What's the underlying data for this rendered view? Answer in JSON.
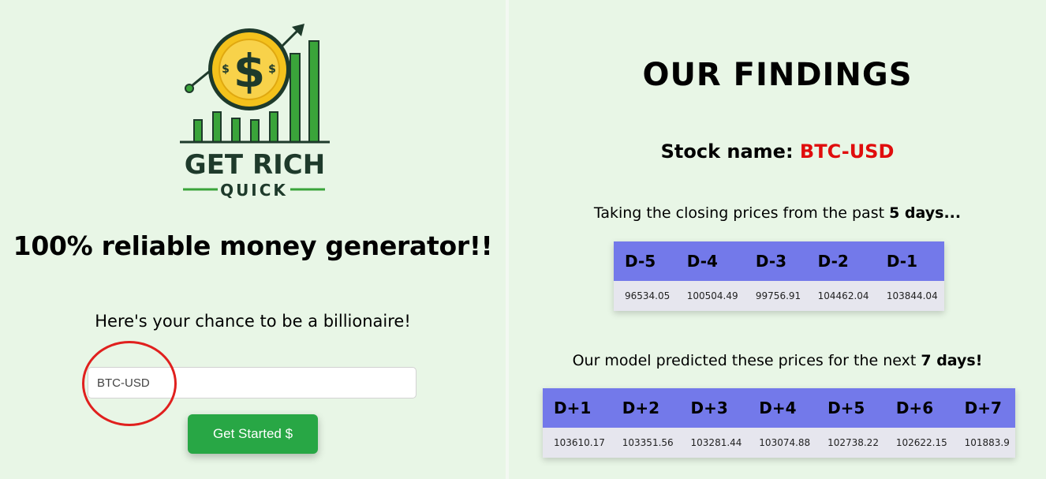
{
  "brand": {
    "logo_line1": "GET RICH",
    "logo_line2": "QUICK",
    "colors": {
      "green": "#3aa43a",
      "dark": "#1e3a2b",
      "coin": "#f4c21c"
    }
  },
  "hero": {
    "headline": "100% reliable money generator!!",
    "subline": "Here's your chance to be a billionaire!"
  },
  "form": {
    "input_value": "BTC-USD",
    "button_label": "Get Started $"
  },
  "findings": {
    "title": "OUR FINDINGS",
    "stock_label": "Stock name:",
    "stock_name": "BTC-USD",
    "past_caption_prefix": "Taking the closing prices from the past",
    "past_caption_bold": "5 days...",
    "pred_caption_prefix": "Our model predicted these prices for the next",
    "pred_caption_bold": "7 days!",
    "past": {
      "headers": [
        "D-5",
        "D-4",
        "D-3",
        "D-2",
        "D-1"
      ],
      "values": [
        "96534.05",
        "100504.49",
        "99756.91",
        "104462.04",
        "103844.04"
      ]
    },
    "predicted": {
      "headers": [
        "D+1",
        "D+2",
        "D+3",
        "D+4",
        "D+5",
        "D+6",
        "D+7"
      ],
      "values": [
        "103610.17",
        "103351.56",
        "103281.44",
        "103074.88",
        "102738.22",
        "102622.15",
        "101883.9"
      ]
    }
  },
  "colors": {
    "background": "#e8f6e6",
    "button": "#28a745",
    "table_header": "#7379ea",
    "stock_name": "#e00d0d",
    "annotation": "#e0201e"
  }
}
